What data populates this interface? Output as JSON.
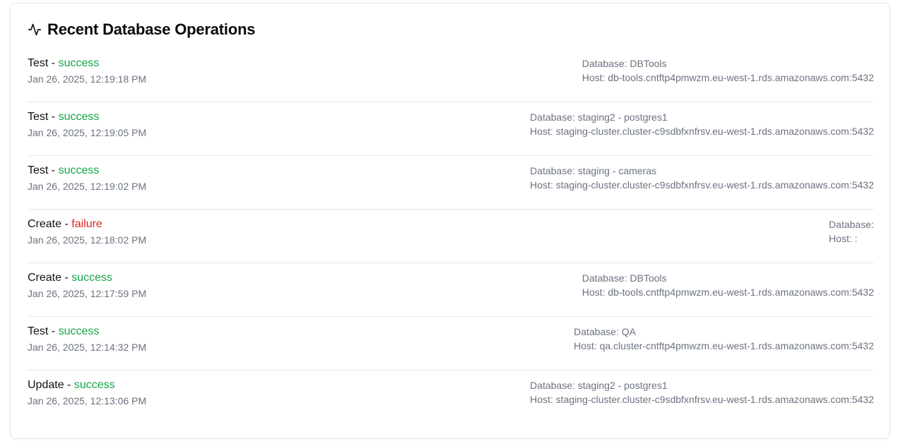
{
  "header": {
    "icon": "activity-icon",
    "title": "Recent Database Operations"
  },
  "colors": {
    "success": "#16a34a",
    "failure": "#dc2626",
    "muted": "#6b7280"
  },
  "operations": [
    {
      "operation": "Test",
      "separator": " - ",
      "status": "success",
      "timestamp": "Jan 26, 2025, 12:19:18 PM",
      "database": "Database: DBTools",
      "host": "Host: db-tools.cntftp4pmwzm.eu-west-1.rds.amazonaws.com:5432"
    },
    {
      "operation": "Test",
      "separator": " - ",
      "status": "success",
      "timestamp": "Jan 26, 2025, 12:19:05 PM",
      "database": "Database: staging2 - postgres1",
      "host": "Host: staging-cluster.cluster-c9sdbfxnfrsv.eu-west-1.rds.amazonaws.com:5432"
    },
    {
      "operation": "Test",
      "separator": " - ",
      "status": "success",
      "timestamp": "Jan 26, 2025, 12:19:02 PM",
      "database": "Database: staging - cameras",
      "host": "Host: staging-cluster.cluster-c9sdbfxnfrsv.eu-west-1.rds.amazonaws.com:5432"
    },
    {
      "operation": "Create",
      "separator": " - ",
      "status": "failure",
      "timestamp": "Jan 26, 2025, 12:18:02 PM",
      "database": "Database:",
      "host": "Host: :"
    },
    {
      "operation": "Create",
      "separator": " - ",
      "status": "success",
      "timestamp": "Jan 26, 2025, 12:17:59 PM",
      "database": "Database: DBTools",
      "host": "Host: db-tools.cntftp4pmwzm.eu-west-1.rds.amazonaws.com:5432"
    },
    {
      "operation": "Test",
      "separator": " - ",
      "status": "success",
      "timestamp": "Jan 26, 2025, 12:14:32 PM",
      "database": "Database: QA",
      "host": "Host: qa.cluster-cntftp4pmwzm.eu-west-1.rds.amazonaws.com:5432"
    },
    {
      "operation": "Update",
      "separator": " - ",
      "status": "success",
      "timestamp": "Jan 26, 2025, 12:13:06 PM",
      "database": "Database: staging2 - postgres1",
      "host": "Host: staging-cluster.cluster-c9sdbfxnfrsv.eu-west-1.rds.amazonaws.com:5432"
    }
  ]
}
